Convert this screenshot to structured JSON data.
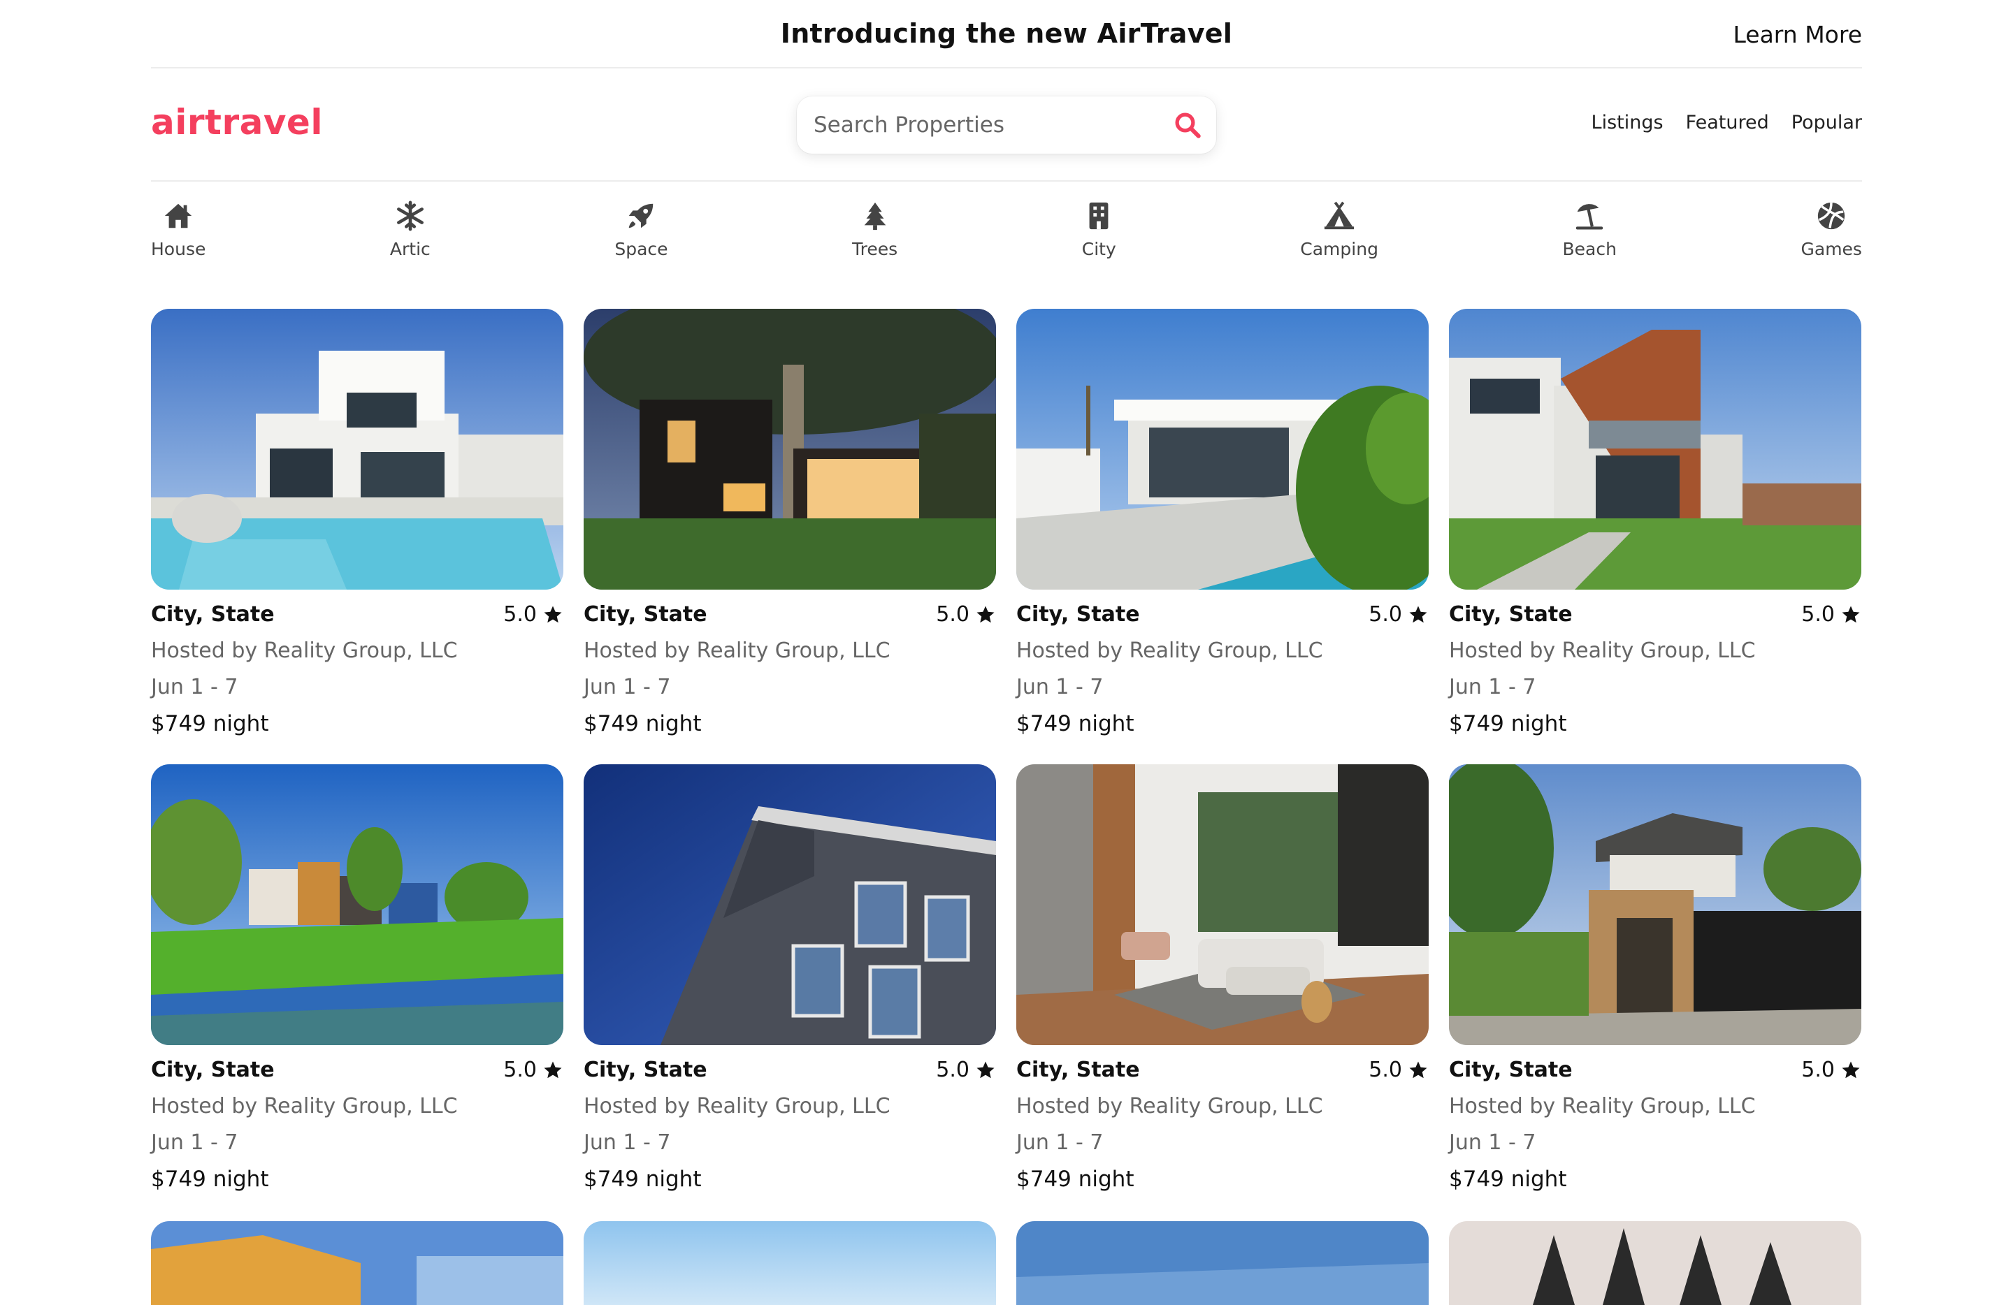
{
  "announcement": {
    "title": "Introducing the new AirTravel",
    "link_label": "Learn More"
  },
  "header": {
    "logo": "airtravel",
    "search": {
      "placeholder": "Search Properties",
      "value": ""
    },
    "nav": [
      "Listings",
      "Featured",
      "Popular"
    ],
    "accent_color": "#f43f5e"
  },
  "categories": [
    {
      "label": "House",
      "icon": "house-icon"
    },
    {
      "label": "Artic",
      "icon": "snowflake-icon"
    },
    {
      "label": "Space",
      "icon": "rocket-icon"
    },
    {
      "label": "Trees",
      "icon": "tree-icon"
    },
    {
      "label": "City",
      "icon": "building-icon"
    },
    {
      "label": "Camping",
      "icon": "tent-icon"
    },
    {
      "label": "Beach",
      "icon": "umbrella-beach-icon"
    },
    {
      "label": "Games",
      "icon": "volleyball-icon"
    }
  ],
  "listings": [
    {
      "location": "City, State",
      "rating": "5.0",
      "host": "Hosted by Reality Group, LLC",
      "dates": "Jun 1 - 7",
      "price": "$749 night",
      "photo": "white modern villa with pool"
    },
    {
      "location": "City, State",
      "rating": "5.0",
      "host": "Hosted by Reality Group, LLC",
      "dates": "Jun 1 - 7",
      "price": "$749 night",
      "photo": "modern house at dusk with tree"
    },
    {
      "location": "City, State",
      "rating": "5.0",
      "host": "Hosted by Reality Group, LLC",
      "dates": "Jun 1 - 7",
      "price": "$749 night",
      "photo": "white house with pool and plant"
    },
    {
      "location": "City, State",
      "rating": "5.0",
      "host": "Hosted by Reality Group, LLC",
      "dates": "Jun 1 - 7",
      "price": "$749 night",
      "photo": "modern house with wood cladding"
    },
    {
      "location": "City, State",
      "rating": "5.0",
      "host": "Hosted by Reality Group, LLC",
      "dates": "Jun 1 - 7",
      "price": "$749 night",
      "photo": "houses by a canal"
    },
    {
      "location": "City, State",
      "rating": "5.0",
      "host": "Hosted by Reality Group, LLC",
      "dates": "Jun 1 - 7",
      "price": "$749 night",
      "photo": "brick facade against blue sky"
    },
    {
      "location": "City, State",
      "rating": "5.0",
      "host": "Hosted by Reality Group, LLC",
      "dates": "Jun 1 - 7",
      "price": "$749 night",
      "photo": "living room interior"
    },
    {
      "location": "City, State",
      "rating": "5.0",
      "host": "Hosted by Reality Group, LLC",
      "dates": "Jun 1 - 7",
      "price": "$749 night",
      "photo": "wood and black modern house"
    }
  ]
}
